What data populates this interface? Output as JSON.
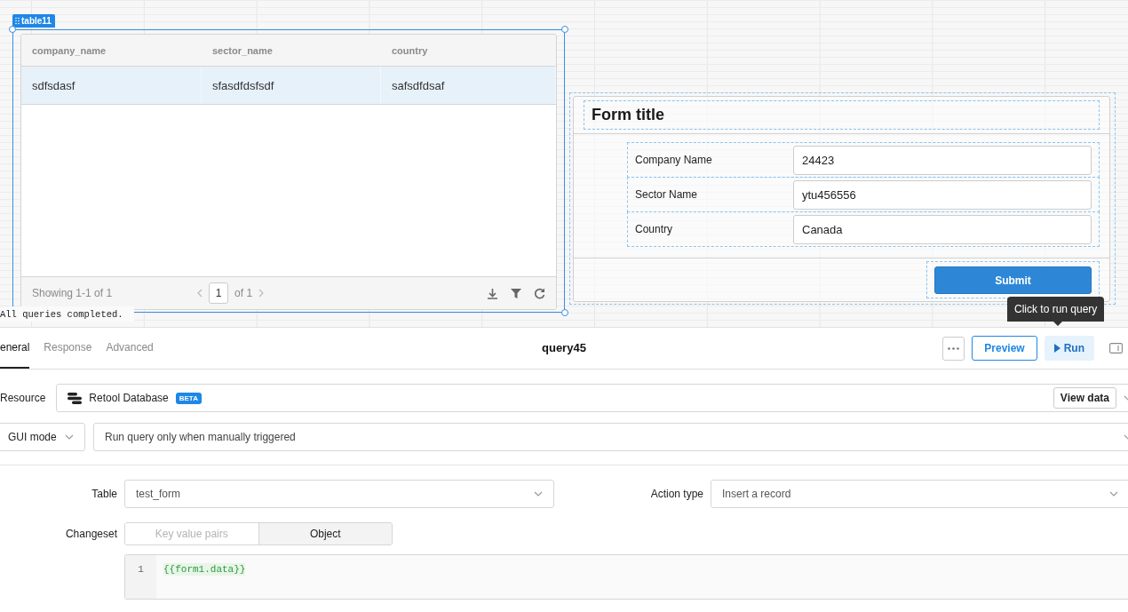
{
  "canvas": {
    "table": {
      "label": "table11",
      "columns": [
        "company_name",
        "sector_name",
        "country"
      ],
      "rows": [
        {
          "cells": [
            "sdfsdasf",
            "sfasdfdsfsdf",
            "safsdfdsaf"
          ],
          "selected": true
        }
      ],
      "footer": {
        "showing": "Showing 1-1 of 1",
        "page": "1",
        "of": "of 1"
      }
    },
    "status": "All queries completed.",
    "form": {
      "title": "Form title",
      "fields": [
        {
          "label": "Company Name",
          "value": "24423"
        },
        {
          "label": "Sector Name",
          "value": "ytu456556"
        },
        {
          "label": "Country",
          "value": "Canada"
        }
      ],
      "submit": "Submit"
    },
    "tooltip": "Click to run query"
  },
  "query": {
    "tabs": [
      {
        "label": "eneral",
        "selected": true
      },
      {
        "label": "Response",
        "selected": false
      },
      {
        "label": "Advanced",
        "selected": false
      }
    ],
    "name": "query45",
    "preview": "Preview",
    "run": "Run",
    "resource": {
      "label": "Resource",
      "value": "Retool Database",
      "badge": "BETA",
      "view": "View data"
    },
    "mode": {
      "value": "GUI mode",
      "trigger": "Run query only when manually triggered"
    },
    "table": {
      "label": "Table",
      "value": "test_form"
    },
    "action": {
      "label": "Action type",
      "value": "Insert a record"
    },
    "changeset": {
      "label": "Changeset",
      "options": [
        {
          "label": "Key value pairs",
          "selected": false
        },
        {
          "label": "Object",
          "selected": true
        }
      ]
    },
    "code": [
      {
        "line": "1",
        "text": "{{form1.data}}"
      }
    ]
  }
}
